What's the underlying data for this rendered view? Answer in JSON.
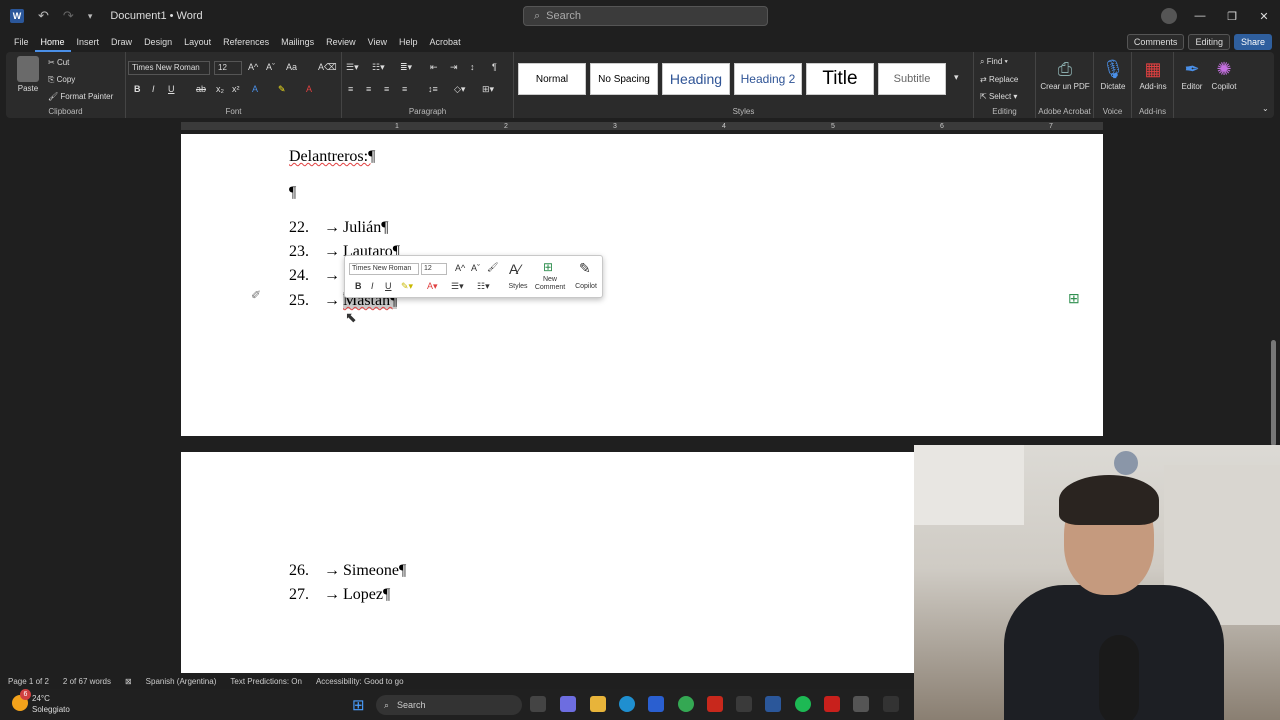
{
  "window": {
    "title": "Document1 • Word",
    "search_placeholder": "Search"
  },
  "menu": {
    "items": [
      "File",
      "Home",
      "Insert",
      "Draw",
      "Design",
      "Layout",
      "References",
      "Mailings",
      "Review",
      "View",
      "Help",
      "Acrobat"
    ],
    "active": "Home",
    "comments": "Comments",
    "editing": "Editing",
    "share": "Share"
  },
  "ribbon": {
    "clipboard": {
      "paste": "Paste",
      "cut": "Cut",
      "copy": "Copy",
      "format_painter": "Format Painter",
      "label": "Clipboard"
    },
    "font": {
      "name": "Times New Roman",
      "size": "12",
      "label": "Font"
    },
    "paragraph": {
      "label": "Paragraph"
    },
    "styles": {
      "label": "Styles",
      "items": [
        "Normal",
        "No Spacing",
        "Heading",
        "Heading 2",
        "Title",
        "Subtitle"
      ]
    },
    "editing": {
      "find": "Find",
      "replace": "Replace",
      "select": "Select",
      "label": "Editing"
    },
    "acrobat": {
      "create_pdf": "Crear un PDF",
      "label": "Adobe Acrobat"
    },
    "voice": {
      "dictate": "Dictate",
      "label": "Voice"
    },
    "addins": {
      "addins": "Add-ins",
      "label": "Add-ins"
    },
    "editor": {
      "editor": "Editor"
    },
    "copilot": {
      "copilot": "Copilot"
    }
  },
  "ruler": {
    "ticks": [
      "1",
      "2",
      "3",
      "4",
      "5",
      "6",
      "7"
    ]
  },
  "document": {
    "page1": {
      "heading": "Delantreros:¶",
      "blank": "¶",
      "list": [
        {
          "num": "22.",
          "arrow": "→",
          "text": "Julián¶"
        },
        {
          "num": "23.",
          "arrow": "→",
          "text": "Lautaro¶"
        },
        {
          "num": "24.",
          "arrow": "→",
          "text": ""
        },
        {
          "num": "25.",
          "arrow": "→",
          "text": "Mastán¶"
        }
      ]
    },
    "page2": {
      "list": [
        {
          "num": "26.",
          "arrow": "→",
          "text": "Simeone¶"
        },
        {
          "num": "27.",
          "arrow": "→",
          "text": "Lopez¶"
        }
      ]
    }
  },
  "mini_toolbar": {
    "font": "Times New Roman",
    "size": "12",
    "styles": "Styles",
    "new_comment": "New Comment",
    "copilot": "Copilot"
  },
  "status": {
    "page": "Page 1 of 2",
    "words": "2 of 67 words",
    "language": "Spanish (Argentina)",
    "predictions": "Text Predictions: On",
    "accessibility": "Accessibility: Good to go"
  },
  "taskbar": {
    "temp": "24°C",
    "condition": "Soleggiato",
    "search": "Search",
    "badge": "6"
  },
  "colors": {
    "accent": "#4a8fe7",
    "word_blue": "#2b579a"
  }
}
